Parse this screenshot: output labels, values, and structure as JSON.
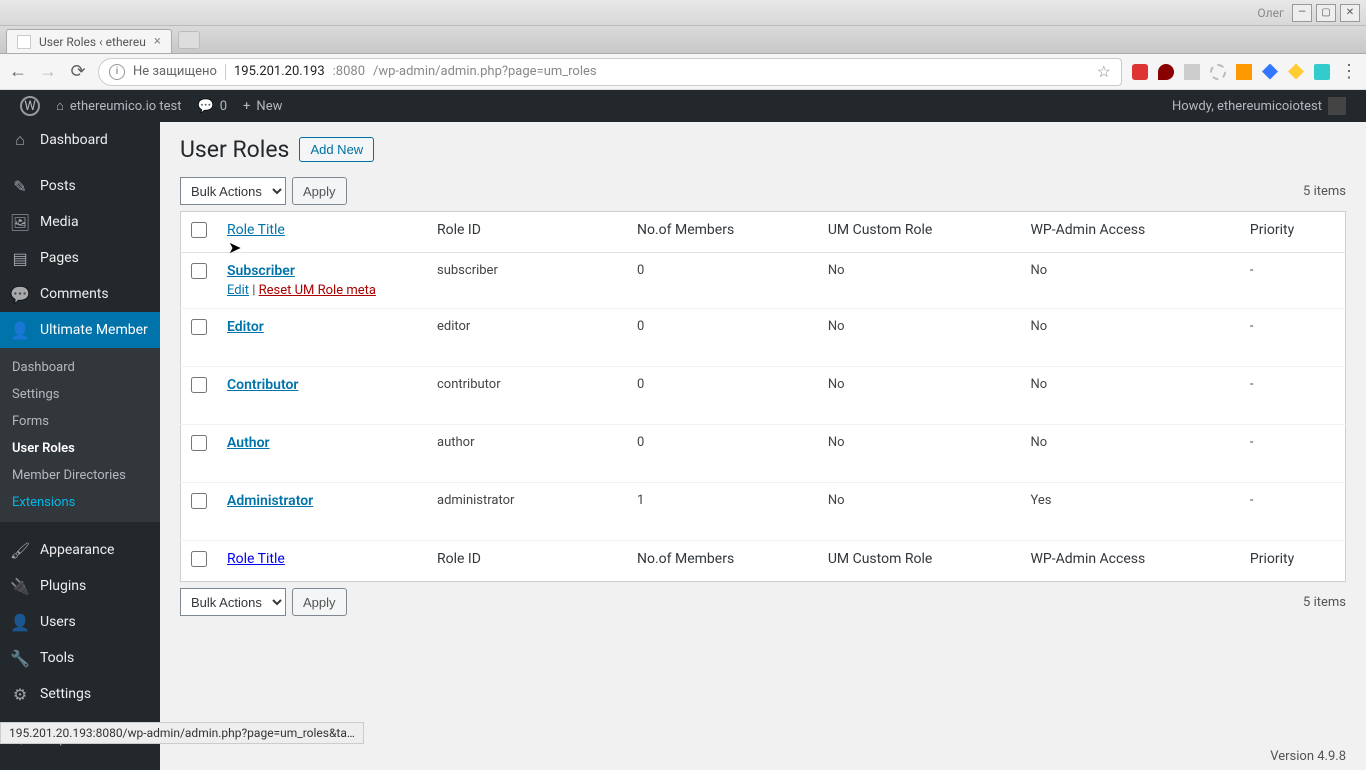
{
  "window": {
    "username_label": "Олег",
    "tab_title": "User Roles ‹ ethereu",
    "url_insecure": "Не защищено",
    "url_host": "195.201.20.193",
    "url_port": ":8080",
    "url_path": "/wp-admin/admin.php?page=um_roles",
    "status_url": "195.201.20.193:8080/wp-admin/admin.php?page=um_roles&ta…"
  },
  "adminbar": {
    "site_name": "ethereumico.io test",
    "comments_count": "0",
    "new_label": "New",
    "howdy": "Howdy, ethereumicoiotest"
  },
  "sidebar": {
    "items": [
      {
        "label": "Dashboard",
        "icon": "⌂"
      },
      {
        "label": "Posts",
        "icon": "✎"
      },
      {
        "label": "Media",
        "icon": "🖼"
      },
      {
        "label": "Pages",
        "icon": "▤"
      },
      {
        "label": "Comments",
        "icon": "💬"
      },
      {
        "label": "Ultimate Member",
        "icon": "👤"
      },
      {
        "label": "Appearance",
        "icon": "🖌"
      },
      {
        "label": "Plugins",
        "icon": "🔌"
      },
      {
        "label": "Users",
        "icon": "👤"
      },
      {
        "label": "Tools",
        "icon": "🔧"
      },
      {
        "label": "Settings",
        "icon": "⚙"
      }
    ],
    "submenu": [
      "Dashboard",
      "Settings",
      "Forms",
      "User Roles",
      "Member Directories",
      "Extensions"
    ],
    "collapse": "Collapse menu"
  },
  "page": {
    "title": "User Roles",
    "add_new": "Add New",
    "bulk_actions": "Bulk Actions",
    "apply": "Apply",
    "count": "5 items",
    "columns": {
      "role_title": "Role Title",
      "role_id": "Role ID",
      "members": "No.of Members",
      "custom": "UM Custom Role",
      "access": "WP-Admin Access",
      "priority": "Priority"
    },
    "row_actions": {
      "edit": "Edit",
      "sep": " | ",
      "reset": "Reset UM Role meta"
    },
    "roles": [
      {
        "title": "Subscriber",
        "id": "subscriber",
        "members": "0",
        "custom": "No",
        "access": "No",
        "priority": "-",
        "hover": true
      },
      {
        "title": "Editor",
        "id": "editor",
        "members": "0",
        "custom": "No",
        "access": "No",
        "priority": "-"
      },
      {
        "title": "Contributor",
        "id": "contributor",
        "members": "0",
        "custom": "No",
        "access": "No",
        "priority": "-"
      },
      {
        "title": "Author",
        "id": "author",
        "members": "0",
        "custom": "No",
        "access": "No",
        "priority": "-"
      },
      {
        "title": "Administrator",
        "id": "administrator",
        "members": "1",
        "custom": "No",
        "access": "Yes",
        "priority": "-"
      }
    ],
    "footer_version": "Version 4.9.8"
  }
}
